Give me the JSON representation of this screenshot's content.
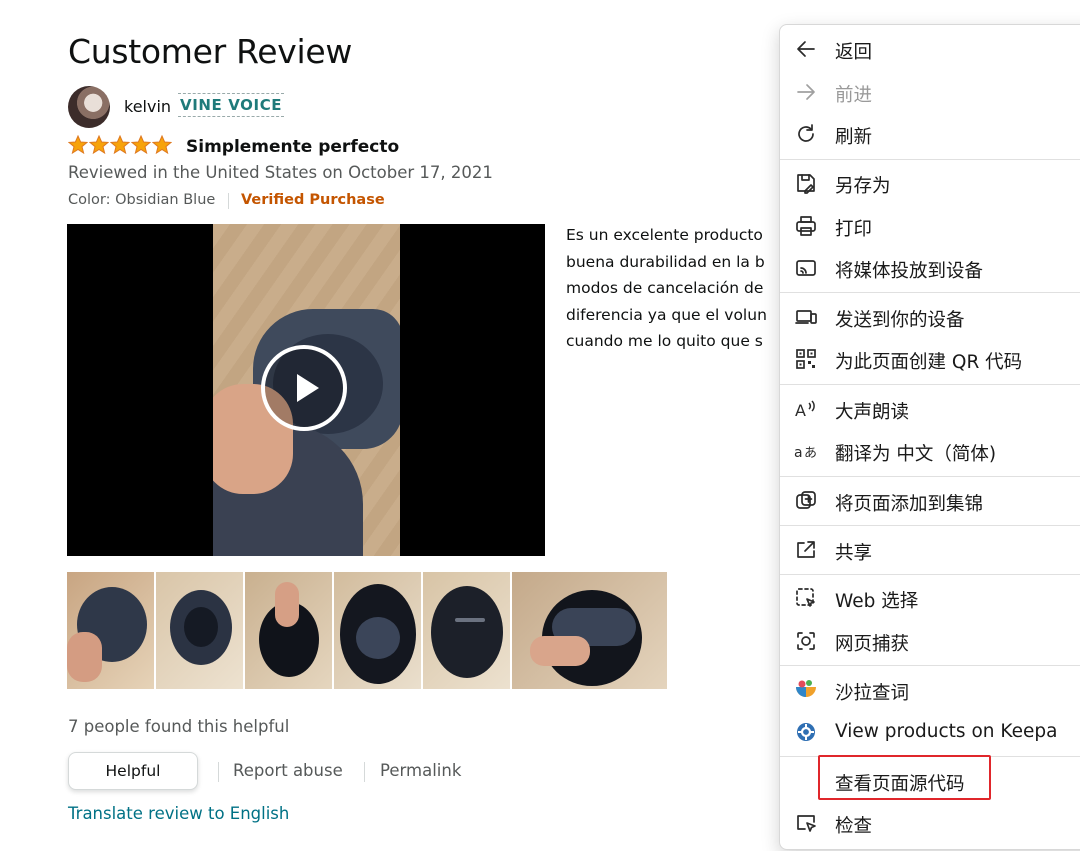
{
  "review": {
    "heading": "Customer Review",
    "reviewer": "kelvin",
    "badge": "VINE VOICE",
    "rating": 5,
    "title": "Simplemente perfecto",
    "date_line": "Reviewed in the United States on October 17, 2021",
    "color": "Color: Obsidian Blue",
    "verified": "Verified Purchase",
    "body_lines": [
      " Es un excelente producto",
      "buena durabilidad en la b",
      "modos de cancelación de",
      "diferencia ya que el volun",
      "cuando me lo quito que s"
    ],
    "helpful_count": "7 people found this helpful",
    "helpful_button": "Helpful",
    "report_abuse": "Report abuse",
    "permalink": "Permalink",
    "translate": "Translate review to English"
  },
  "colors": {
    "star": "#f7a30a",
    "vine": "#1f7a7a",
    "verified": "#c45500",
    "link": "#007185",
    "highlight": "#e0262b"
  },
  "context_menu": {
    "items": [
      {
        "label": "返回",
        "icon": "back-arrow-icon"
      },
      {
        "label": "前进",
        "icon": "forward-arrow-icon",
        "disabled": true
      },
      {
        "label": "刷新",
        "icon": "refresh-icon"
      },
      {
        "label": "另存为",
        "icon": "save-as-icon"
      },
      {
        "label": "打印",
        "icon": "print-icon"
      },
      {
        "label": "将媒体投放到设备",
        "icon": "cast-icon"
      },
      {
        "label": "发送到你的设备",
        "icon": "send-to-device-icon"
      },
      {
        "label": "为此页面创建 QR 代码",
        "icon": "qr-code-icon"
      },
      {
        "label": "大声朗读",
        "icon": "read-aloud-icon"
      },
      {
        "label": "翻译为 中文（简体)",
        "icon": "translate-icon"
      },
      {
        "label": "将页面添加到集锦",
        "icon": "add-to-collection-icon"
      },
      {
        "label": "共享",
        "icon": "share-icon"
      },
      {
        "label": "Web 选择",
        "icon": "web-select-icon"
      },
      {
        "label": "网页捕获",
        "icon": "web-capture-icon"
      },
      {
        "label": "沙拉查词",
        "icon": "saladict-icon"
      },
      {
        "label": "View products on Keepa",
        "icon": "keepa-icon"
      },
      {
        "label": "查看页面源代码",
        "icon": "view-source-icon",
        "highlighted": true
      },
      {
        "label": "检查",
        "icon": "inspect-icon"
      }
    ]
  }
}
